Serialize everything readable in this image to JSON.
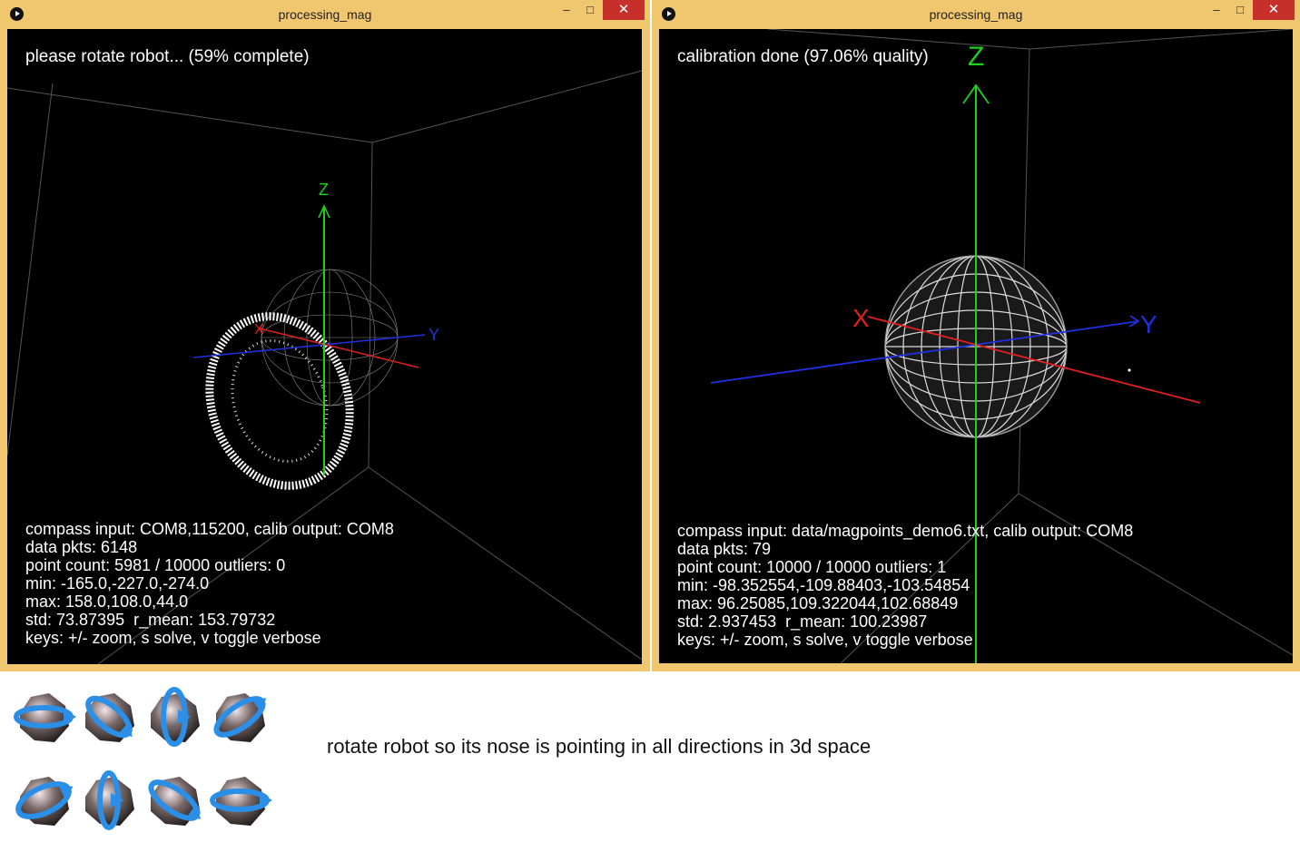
{
  "left_window": {
    "title": "processing_mag",
    "status": "please rotate robot... (59% complete)",
    "axes": {
      "x": "X",
      "y": "Y",
      "z": "Z"
    },
    "info": [
      "compass input: COM8,115200, calib output: COM8",
      "data pkts: 6148",
      "point count: 5981 / 10000 outliers: 0",
      "min: -165.0,-227.0,-274.0",
      "max: 158.0,108.0,44.0",
      "std: 73.87395  r_mean: 153.79732",
      "keys: +/- zoom, s solve, v toggle verbose"
    ]
  },
  "right_window": {
    "title": "processing_mag",
    "status": "calibration done (97.06% quality)",
    "axes": {
      "x": "X",
      "y": "Y",
      "z": "Z"
    },
    "info": [
      "compass input: data/magpoints_demo6.txt, calib output: COM8",
      "data pkts: 79",
      "point count: 10000 / 10000 outliers: 1",
      "min: -98.352554,-109.88403,-103.54854",
      "max: 96.25085,109.322044,102.68849",
      "std: 2.937453  r_mean: 100.23987",
      "keys: +/- zoom, s solve, v toggle verbose"
    ]
  },
  "window_buttons": {
    "minimize": "–",
    "maximize": "□",
    "close": "✕"
  },
  "caption": "rotate robot so its nose is pointing in all directions in 3d space",
  "colors": {
    "frame": "#f0c66f",
    "x_axis": "#e02020",
    "y_axis": "#2030e0",
    "z_axis": "#20d020",
    "close": "#c7302a"
  },
  "rotation_icons": [
    "rotate-yaw-icon",
    "rotate-pitch-icon",
    "rotate-roll-icon",
    "rotate-tilt-icon",
    "rotate-flip-icon",
    "rotate-up-icon",
    "rotate-spin-icon",
    "rotate-yaw-reverse-icon"
  ]
}
